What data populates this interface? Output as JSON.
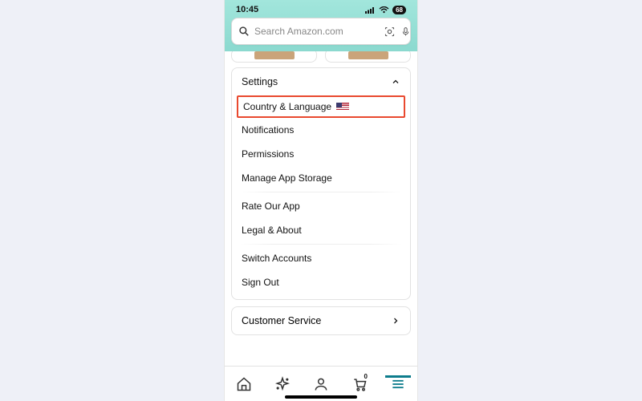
{
  "status": {
    "time": "10:45",
    "battery": "68"
  },
  "search": {
    "placeholder": "Search Amazon.com"
  },
  "settings": {
    "title": "Settings",
    "items": {
      "country_language": "Country & Language",
      "notifications": "Notifications",
      "permissions": "Permissions",
      "manage_storage": "Manage App Storage",
      "rate_app": "Rate Our App",
      "legal_about": "Legal & About",
      "switch_accounts": "Switch Accounts",
      "sign_out": "Sign Out"
    }
  },
  "customer_service": "Customer Service",
  "cart_count": "0",
  "highlight": "country_language"
}
